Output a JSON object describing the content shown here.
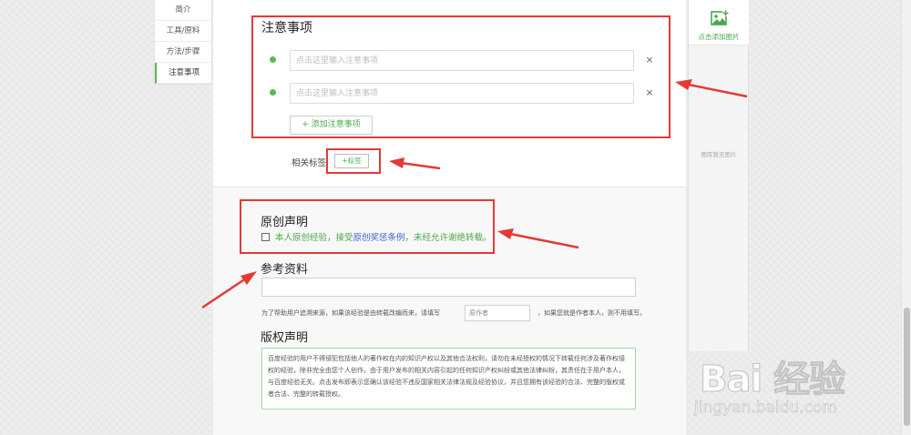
{
  "nav": {
    "items": [
      {
        "label": "简介"
      },
      {
        "label": "工具/原料"
      },
      {
        "label": "方法/步骤"
      },
      {
        "label": "注意事项"
      }
    ]
  },
  "notes": {
    "title": "注意事项",
    "placeholder": "点击这里输入注意事项",
    "close_symbol": "×",
    "add_label": "+ 添加注意事项"
  },
  "tags": {
    "label": "相关标签",
    "add_label": "+标签"
  },
  "declaration": {
    "title": "原创声明",
    "text_prefix": "本人原创经验，接受",
    "link_text": "原创奖惩条例",
    "text_suffix": "，未经允许谢绝转载。"
  },
  "reference": {
    "title": "参考资料",
    "hint_prefix": "为了帮助用户追溯来源，如果该经验是由转载改编而来，请填写",
    "author_placeholder": "原作者",
    "hint_suffix": "，如果您就是作者本人，则不用填写。"
  },
  "copyright": {
    "title": "版权声明",
    "text": "百度经验的用户不得侵犯包括他人的著作权在内的知识产权以及其他合法权利，请勿在未经授权的情况下转载任何涉及著作权侵权的经验，除非完全由您个人创作。由于用户发布的相关内容引起的任何知识产权纠纷或其他法律纠纷，其责任在于用户本人，与百度经验无关。点击发布即表示您确认该经验不违反国家相关法律法规及经验协议，并且您拥有该经验的合法、完整的版权或者合法、完整的转载授权。"
  },
  "gallery": {
    "add_label": "点击添加图片",
    "empty_label": "图库暂无图片"
  },
  "watermark": {
    "logo": "Bai 经验",
    "url": "jingyan.baidu.com"
  },
  "colors": {
    "accent_green": "#5cb85c",
    "link_blue": "#3366cc",
    "annotation_red": "#e53935"
  }
}
